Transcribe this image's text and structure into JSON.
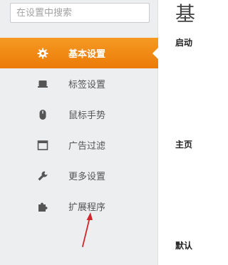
{
  "search": {
    "placeholder": "在设置中搜索"
  },
  "sidebar": {
    "items": [
      {
        "label": "基本设置",
        "icon": "gear-icon",
        "active": true
      },
      {
        "label": "标签设置",
        "icon": "laptop-icon",
        "active": false
      },
      {
        "label": "鼠标手势",
        "icon": "mouse-icon",
        "active": false
      },
      {
        "label": "广告过滤",
        "icon": "window-icon",
        "active": false
      },
      {
        "label": "更多设置",
        "icon": "wrench-icon",
        "active": false
      },
      {
        "label": "扩展程序",
        "icon": "puzzle-icon",
        "active": false
      }
    ]
  },
  "main": {
    "title": "基",
    "sections": [
      "启动",
      "主页",
      "默认"
    ]
  },
  "colors": {
    "accent": "#f08a14",
    "sidebar_bg": "#eceef0",
    "arrow": "#d0282c"
  }
}
